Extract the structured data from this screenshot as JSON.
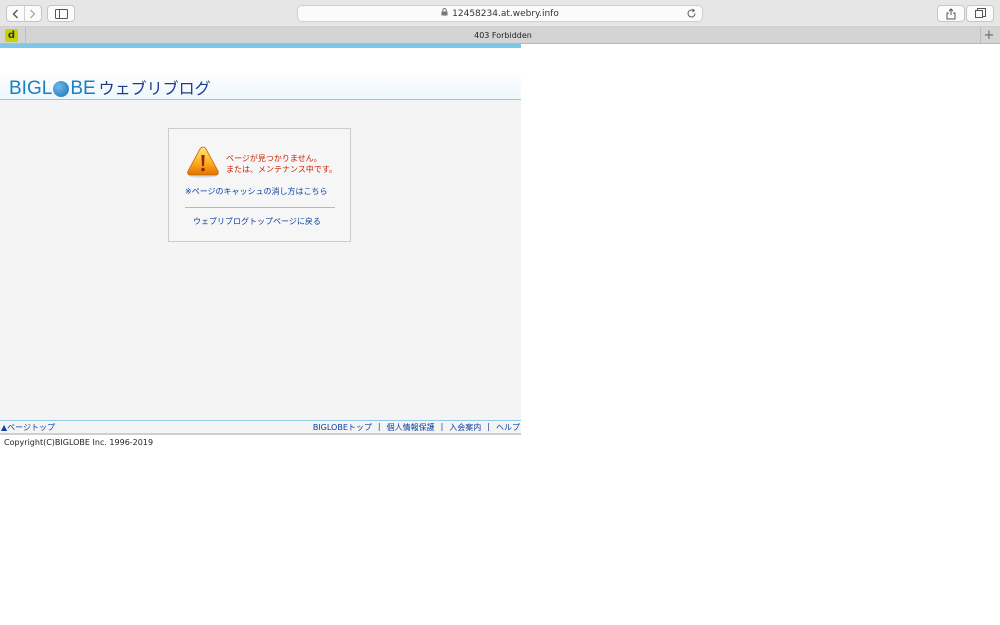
{
  "browser": {
    "url": "12458234.at.webry.info",
    "tab_title": "403 Forbidden",
    "favicon_letter": "d",
    "new_tab_label": "+"
  },
  "header": {
    "logo_text_1": "BIGL",
    "logo_text_2": "BE",
    "logo_sub": "ウェブリブログ"
  },
  "error": {
    "message_line1": "ページが見つかりません。",
    "message_line2": "または、メンテナンス中です。",
    "cache_link": "※ページのキャッシュの消し方はこちら",
    "back_link": "ウェブリブログトップページに戻る"
  },
  "footer": {
    "page_top": "▲ページトップ",
    "links": [
      "BIGLOBEトップ",
      "個人情報保護",
      "入会案内",
      "ヘルプ"
    ],
    "separator": "|",
    "copyright": "Copyright(C)BIGLOBE Inc. 1996-2019"
  },
  "colors": {
    "accent_blue": "#1a7fc1",
    "link_blue": "#0b3ea0",
    "error_red": "#cc2200",
    "strip": "#7fc7e6"
  }
}
